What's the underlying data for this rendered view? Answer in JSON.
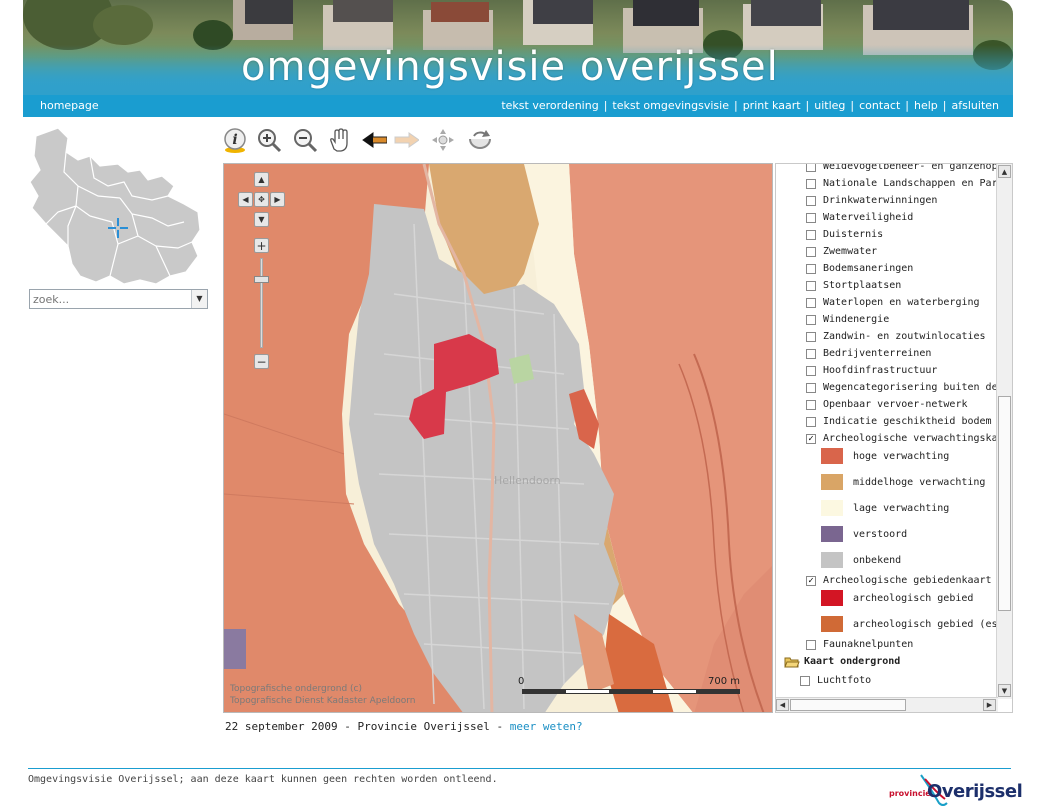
{
  "header": {
    "title": "omgevingsvisie overijssel",
    "nav_home": "homepage",
    "nav_links": [
      "tekst verordening",
      "tekst omgevingsvisie",
      "print kaart",
      "uitleg",
      "contact",
      "help",
      "afsluiten"
    ],
    "separator": "|"
  },
  "search": {
    "placeholder": "zoek..."
  },
  "toolbar": {
    "tools": [
      "info-icon",
      "zoom-in-icon",
      "zoom-out-icon",
      "pan-hand-icon",
      "back-arrow-icon",
      "forward-arrow-icon",
      "full-extent-icon",
      "refresh-icon"
    ]
  },
  "map": {
    "place_label": "Hellendoorn",
    "scale_start": "0",
    "scale_end": "700 m",
    "attribution_line1": "Topografische ondergrond (c)",
    "attribution_line2": "Topografische Dienst Kadaster Apeldoorn",
    "colors": {
      "hoge": "#d9654b",
      "middelhoge": "#d9a566",
      "lage": "#fcf8e1",
      "verstoord": "#7a6690",
      "onbekend": "#c4c4c4",
      "archeologisch_gebied": "#d31524",
      "archeologisch_es": "#d06a36"
    }
  },
  "legend": {
    "layers": [
      {
        "label": "Weidevogelbeheer- en ganzenopvanggebieden",
        "checked": false
      },
      {
        "label": "Nationale Landschappen en Parken",
        "checked": false
      },
      {
        "label": "Drinkwaterwinningen",
        "checked": false
      },
      {
        "label": "Waterveiligheid",
        "checked": false
      },
      {
        "label": "Duisternis",
        "checked": false
      },
      {
        "label": "Zwemwater",
        "checked": false
      },
      {
        "label": "Bodemsaneringen",
        "checked": false
      },
      {
        "label": "Stortplaatsen",
        "checked": false
      },
      {
        "label": "Waterlopen en waterberging",
        "checked": false
      },
      {
        "label": "Windenergie",
        "checked": false
      },
      {
        "label": "Zandwin- en zoutwinlocaties",
        "checked": false
      },
      {
        "label": "Bedrijventerreinen",
        "checked": false
      },
      {
        "label": "Hoofdinfrastructuur",
        "checked": false
      },
      {
        "label": "Wegencategorisering buiten de bebouwde kom",
        "checked": false
      },
      {
        "label": "Openbaar vervoer-netwerk",
        "checked": false
      },
      {
        "label": "Indicatie geschiktheid bodem voor warmte-koudeopslag",
        "checked": false
      },
      {
        "label": "Archeologische verwachtingskaart",
        "checked": true
      }
    ],
    "verwachting_items": [
      {
        "label": "hoge verwachting",
        "color": "#d9654b"
      },
      {
        "label": "middelhoge verwachting",
        "color": "#d9a566"
      },
      {
        "label": "lage verwachting",
        "color": "#fcf8e1"
      },
      {
        "label": "verstoord",
        "color": "#7a6690"
      },
      {
        "label": "onbekend",
        "color": "#c4c4c4"
      }
    ],
    "gebieden_layer": {
      "label": "Archeologische gebiedenkaart",
      "checked": true
    },
    "gebieden_items": [
      {
        "label": "archeologisch gebied",
        "color": "#d31524"
      },
      {
        "label": "archeologisch gebied (es)",
        "color": "#d06a36"
      }
    ],
    "fauna_layer": {
      "label": "Faunaknelpunten",
      "checked": false
    },
    "group_label": "Kaart ondergrond",
    "luchtfoto_label": "Luchtfoto"
  },
  "footer": {
    "date_text": "22 september 2009 - Provincie Overijssel - ",
    "meer_weten": "meer weten?",
    "disclaimer": "Omgevingsvisie Overijssel; aan deze kaart kunnen geen rechten worden ontleend.",
    "logo_small": "provincie",
    "logo_big": "Overijssel"
  }
}
